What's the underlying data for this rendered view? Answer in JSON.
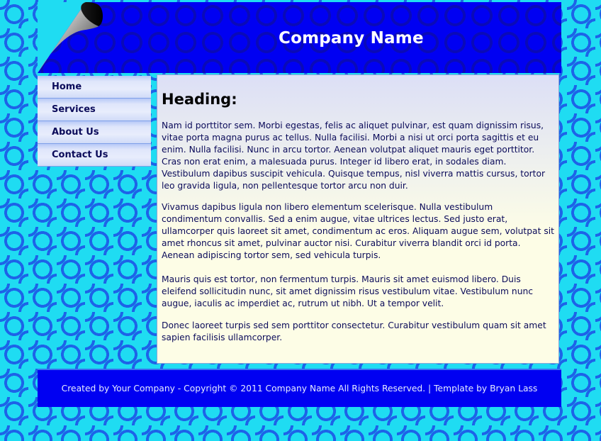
{
  "header": {
    "title": "Company Name"
  },
  "nav": {
    "items": [
      {
        "label": "Home"
      },
      {
        "label": "Services"
      },
      {
        "label": "About Us"
      },
      {
        "label": "Contact Us"
      }
    ]
  },
  "content": {
    "heading": "Heading:",
    "paragraphs": [
      "Nam id porttitor sem. Morbi egestas, felis ac aliquet pulvinar, est quam dignissim risus, vitae porta magna purus ac tellus. Nulla facilisi. Morbi a nisi ut orci porta sagittis et eu enim. Nulla facilisi. Nunc in arcu tortor. Aenean volutpat aliquet mauris eget porttitor. Cras non erat enim, a malesuada purus. Integer id libero erat, in sodales diam. Vestibulum dapibus suscipit vehicula. Quisque tempus, nisl viverra mattis cursus, tortor leo gravida ligula, non pellentesque tortor arcu non duir.",
      "Vivamus dapibus ligula non libero elementum scelerisque. Nulla vestibulum condimentum convallis. Sed a enim augue, vitae ultrices lectus. Sed justo erat, ullamcorper quis laoreet sit amet, condimentum ac eros. Aliquam augue sem, volutpat sit amet rhoncus sit amet, pulvinar auctor nisi. Curabitur viverra blandit orci id porta. Aenean adipiscing tortor sem, sed vehicula turpis.",
      "Mauris quis est tortor, non fermentum turpis. Mauris sit amet euismod libero. Duis eleifend sollicitudin nunc, sit amet dignissim risus vestibulum vitae. Vestibulum nunc augue, iaculis ac imperdiet ac, rutrum ut nibh. Ut a tempor velit.",
      "Donec laoreet turpis sed sem porttitor consectetur. Curabitur vestibulum quam sit amet sapien facilisis ullamcorper."
    ]
  },
  "footer": {
    "text": "Created by Your Company - Copyright © 2011 Company Name All Rights Reserved. |  Template by Bryan Lass"
  },
  "colors": {
    "background": "#1fdcf2",
    "header_blue": "#0000f2",
    "text_navy": "#0b0b5a"
  }
}
